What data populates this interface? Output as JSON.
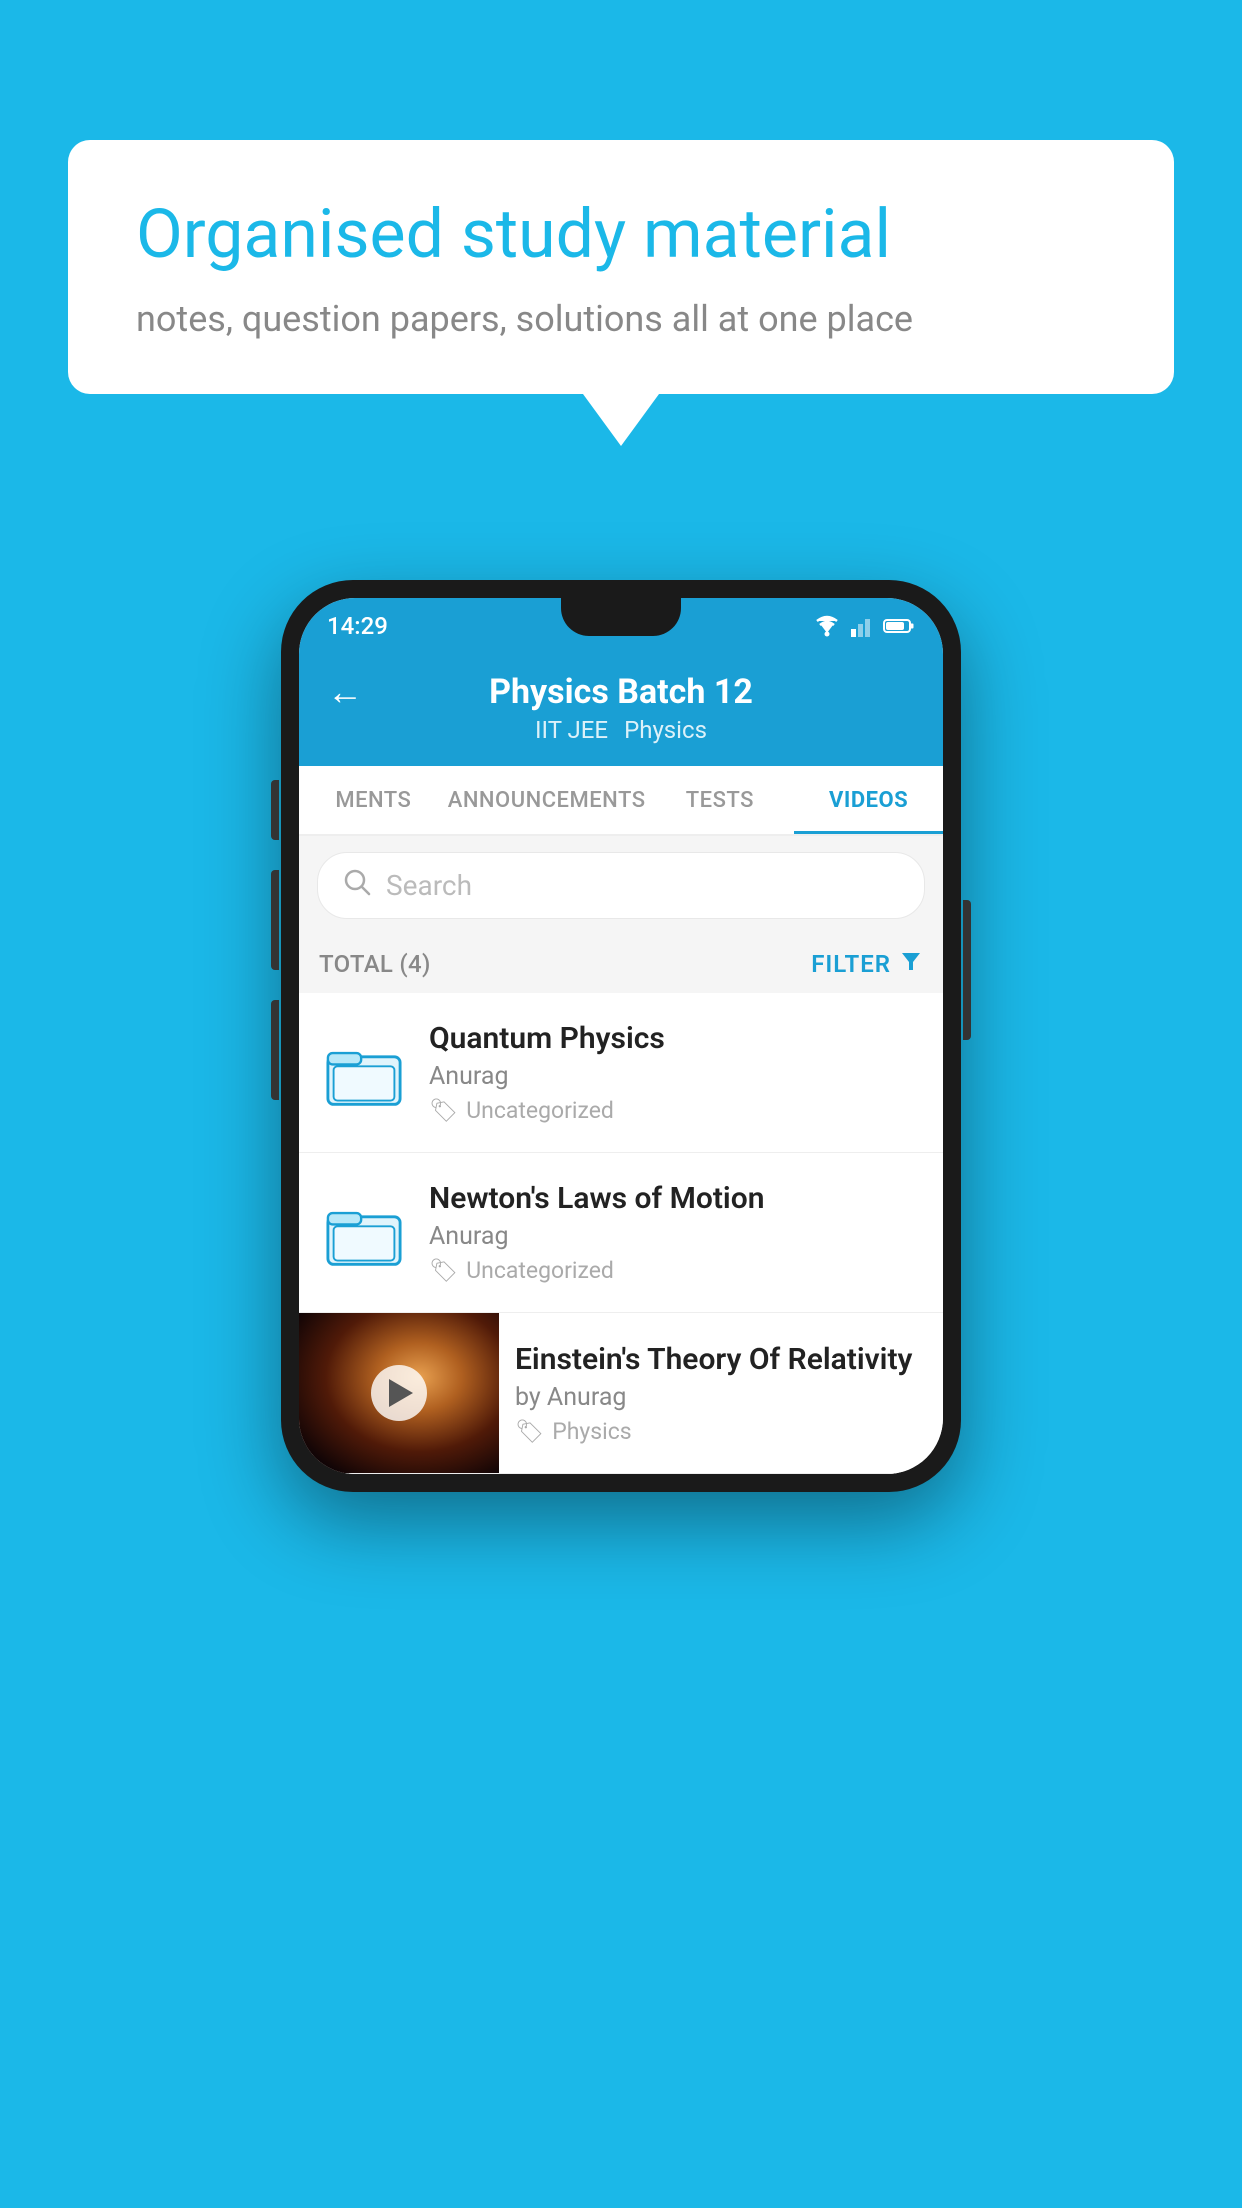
{
  "background_color": "#1bb8e8",
  "speech_bubble": {
    "title": "Organised study material",
    "subtitle": "notes, question papers, solutions all at one place"
  },
  "phone": {
    "status_bar": {
      "time": "14:29"
    },
    "header": {
      "title": "Physics Batch 12",
      "subtitle_left": "IIT JEE",
      "subtitle_right": "Physics",
      "back_label": "←"
    },
    "tabs": [
      {
        "label": "MENTS",
        "active": false
      },
      {
        "label": "ANNOUNCEMENTS",
        "active": false
      },
      {
        "label": "TESTS",
        "active": false
      },
      {
        "label": "VIDEOS",
        "active": true
      }
    ],
    "search": {
      "placeholder": "Search"
    },
    "filter": {
      "total_label": "TOTAL (4)",
      "filter_label": "FILTER"
    },
    "videos": [
      {
        "title": "Quantum Physics",
        "author": "Anurag",
        "tag": "Uncategorized",
        "has_thumbnail": false
      },
      {
        "title": "Newton's Laws of Motion",
        "author": "Anurag",
        "tag": "Uncategorized",
        "has_thumbnail": false
      },
      {
        "title": "Einstein's Theory Of Relativity",
        "author": "by Anurag",
        "tag": "Physics",
        "has_thumbnail": true
      }
    ]
  }
}
